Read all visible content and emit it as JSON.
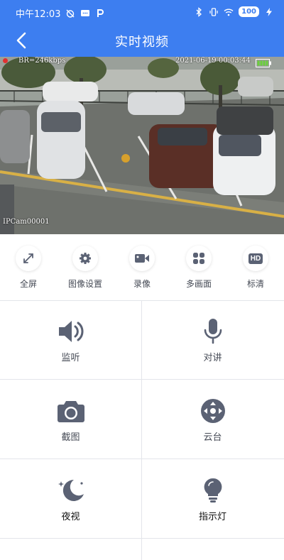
{
  "status_bar": {
    "time": "中午12:03",
    "battery_level": "100"
  },
  "nav": {
    "title": "实时视频"
  },
  "video": {
    "bitrate": "BR=246kbps",
    "timestamp": "2021-06-19 00:03:44",
    "camera_name": "IPCam00001"
  },
  "toolbar": {
    "items": [
      {
        "label": "全屏",
        "icon": "fullscreen-icon"
      },
      {
        "label": "图像设置",
        "icon": "gear-icon"
      },
      {
        "label": "录像",
        "icon": "video-camera-icon"
      },
      {
        "label": "多画面",
        "icon": "grid-icon"
      },
      {
        "label": "标清",
        "icon": "hd-icon",
        "badge": "HD"
      }
    ]
  },
  "controls": {
    "items": [
      {
        "label": "监听",
        "icon": "speaker-icon"
      },
      {
        "label": "对讲",
        "icon": "microphone-icon"
      },
      {
        "label": "截图",
        "icon": "camera-icon"
      },
      {
        "label": "云台",
        "icon": "ptz-icon"
      },
      {
        "label": "夜视",
        "icon": "moon-icon"
      },
      {
        "label": "指示灯",
        "icon": "lightbulb-icon"
      }
    ]
  },
  "colors": {
    "primary": "#3d7ef0",
    "icon": "#5b6274",
    "background": "#f2f3f5"
  }
}
